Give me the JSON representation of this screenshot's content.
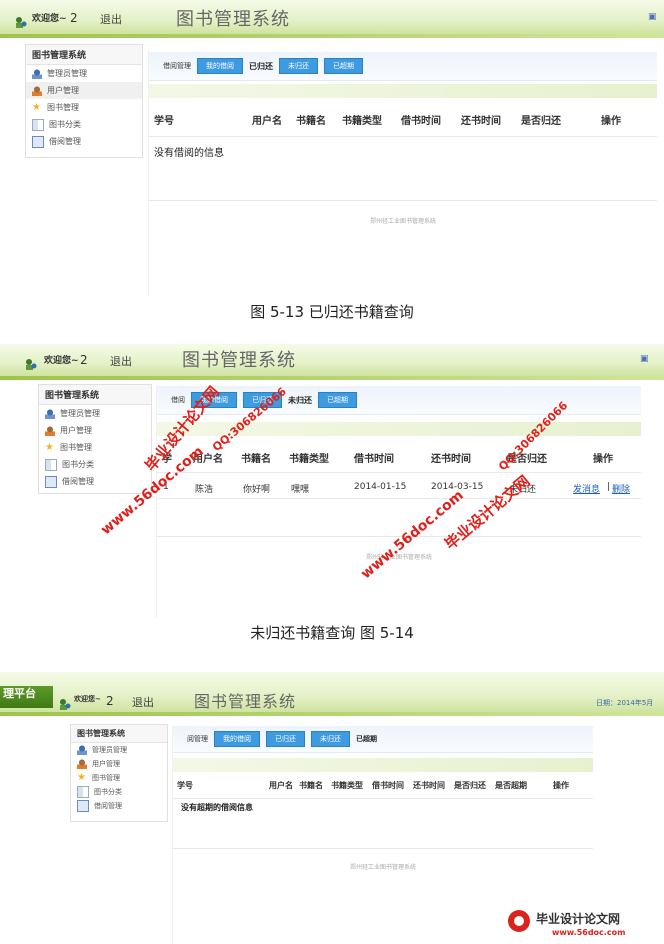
{
  "screens": [
    {
      "welcome": "欢迎您~",
      "user_num": "2",
      "logout": "退出",
      "title": "图书管理系统",
      "sidebar_title": "图书管理系统",
      "sidebar_items": [
        "管理员管理",
        "用户管理",
        "图书管理",
        "图书分类",
        "借阅管理"
      ],
      "tab_label": "借阅管理",
      "tab_my": "我的借阅",
      "tab_current": "已归还",
      "tab_unreturned": "未归还",
      "tab_overdue": "已超期",
      "columns": [
        "学号",
        "用户名",
        "书籍名",
        "书籍类型",
        "借书时间",
        "还书时间",
        "是否归还",
        "操作"
      ],
      "empty_text": "没有借阅的信息",
      "footer": "郑州轻工业图书管理系统",
      "caption": "图 5-13 已归还书籍查询"
    },
    {
      "welcome": "欢迎您~",
      "user_num": "2",
      "logout": "退出",
      "title": "图书管理系统",
      "sidebar_title": "图书管理系统",
      "sidebar_items": [
        "管理员管理",
        "用户管理",
        "图书管理",
        "图书分类",
        "借阅管理"
      ],
      "tab_label": "借阅",
      "tab_my": "我的借阅",
      "tab_returned": "已归还",
      "tab_current": "未归还",
      "tab_overdue": "已超期",
      "columns": [
        "学",
        "用户名",
        "书籍名",
        "书籍类型",
        "借书时间",
        "还书时间",
        "是否归还",
        "操作"
      ],
      "row": {
        "id": "1",
        "user": "陈浩",
        "book": "你好啊",
        "type": "嘿嘿",
        "borrow": "2014-01-15",
        "return": "2014-03-15",
        "returned": "未归还",
        "op_msg": "发消息",
        "op_sep": "|",
        "op_del": "删除"
      },
      "footer": "郑州轻工业图书管理系统",
      "caption": "未归还书籍查询 图 5-14"
    },
    {
      "platform": "理平台",
      "welcome": "欢迎您~",
      "user_num": "2",
      "logout": "退出",
      "title": "图书管理系统",
      "date": "日期：2014年5月",
      "sidebar_title": "图书管理系统",
      "sidebar_items": [
        "管理员管理",
        "用户管理",
        "图书管理",
        "图书分类",
        "借阅管理"
      ],
      "tab_label": "阅管理",
      "tab_my": "我的借阅",
      "tab_returned": "已归还",
      "tab_unreturned": "未归还",
      "tab_current": "已超期",
      "columns": [
        "学号",
        "用户名",
        "书籍名",
        "书籍类型",
        "借书时间",
        "还书时间",
        "是否归还",
        "是否超期",
        "操作"
      ],
      "empty_text": "没有超期的借阅信息",
      "footer": "郑州轻工业图书管理系统"
    }
  ],
  "watermarks": {
    "site_name": "毕业设计论文网",
    "qq": "QQ:306826066",
    "url": "www.56doc.com"
  },
  "bottom_logo": {
    "name": "毕业设计论文网",
    "url": "www.56doc.com"
  }
}
